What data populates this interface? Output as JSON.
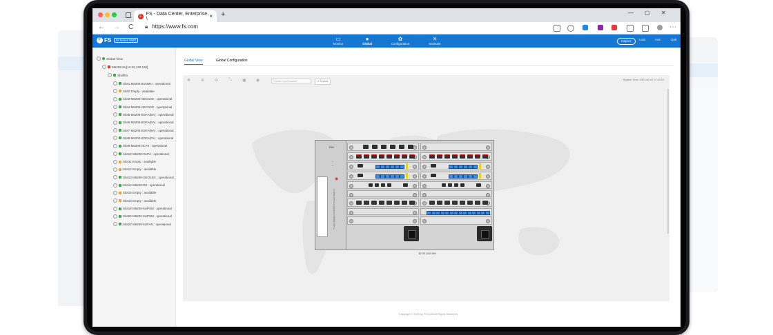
{
  "browser": {
    "tab_title": "FS - Data Center, Enterprise, \\",
    "tab_close": "×",
    "new_tab": "+",
    "url": "https://www.fs.com",
    "back": "←",
    "forward": "→",
    "reload": "C",
    "more": "⋯"
  },
  "app": {
    "logo_text": "FS",
    "badge": "M Series NMS",
    "nav": [
      {
        "label": "Monitor",
        "icon": "▭"
      },
      {
        "label": "Global",
        "icon": "●"
      },
      {
        "label": "Configuration",
        "icon": "✿"
      },
      {
        "label": "Maintain",
        "icon": "✕"
      }
    ],
    "inspect": "Inspect",
    "lock": "Lock",
    "user": "root",
    "quit": "Quit"
  },
  "tree": {
    "root": "Global View",
    "device": "M6200-5U[10.32.130.160]",
    "shelf": "Shelf01",
    "slots": [
      {
        "label": "Slot1 M6200-5UNMU : operational",
        "status": "ok"
      },
      {
        "label": "Slot2 Empty : available",
        "status": "empty"
      },
      {
        "label": "Slot3 M6200-OEO10G : operational",
        "status": "ok"
      },
      {
        "label": "Slot4 M6200-OEO10G : operational",
        "status": "ok"
      },
      {
        "label": "Slot5 M6200-EDFA(BA) : operational",
        "status": "ok"
      },
      {
        "label": "Slot6 M6200-EDFA(BA) : operational",
        "status": "ok"
      },
      {
        "label": "Slot7 M6200-EDFA(BA) : operational",
        "status": "ok"
      },
      {
        "label": "Slot8 M6200-EDFA(PA) : operational",
        "status": "ok"
      },
      {
        "label": "Slot9 M6200-OLP2 : operational",
        "status": "ok"
      },
      {
        "label": "Slot10 M6200-OLP2 : operational",
        "status": "ok"
      },
      {
        "label": "Slot11 Empty : available",
        "status": "empty"
      },
      {
        "label": "Slot12 Empty : available",
        "status": "empty"
      },
      {
        "label": "Slot13 M6200-OEO10G : operational",
        "status": "ok"
      },
      {
        "label": "Slot14 M6200-R8 : operational",
        "status": "ok"
      },
      {
        "label": "Slot15 Empty : available",
        "status": "empty"
      },
      {
        "label": "Slot16 Empty : available",
        "status": "empty"
      },
      {
        "label": "Slot19 M6200-5UPSM : operational",
        "status": "ok"
      },
      {
        "label": "Slot20 M6200-5UPSM : operational",
        "status": "ok"
      },
      {
        "label": "Slot22 M6200-5UFAN : operational",
        "status": "ok"
      }
    ],
    "colors": {
      "ok": "#3aa844",
      "empty": "#f0a23a",
      "device": "#d9342b"
    }
  },
  "main": {
    "tabs": [
      "Global View",
      "Global Configuration"
    ],
    "search_placeholder": "Please input content",
    "search_button": "Search",
    "system_time": "System Time:   2021-09-12 17:10:10",
    "device_fan": "FAN",
    "device_vertical": "5 Layer Modular FS-DCI/FS Transport Platform",
    "device_ip": "10.32.130.160",
    "footer": "Copyright © 2020 by FS.COM All Rights Reserved"
  }
}
